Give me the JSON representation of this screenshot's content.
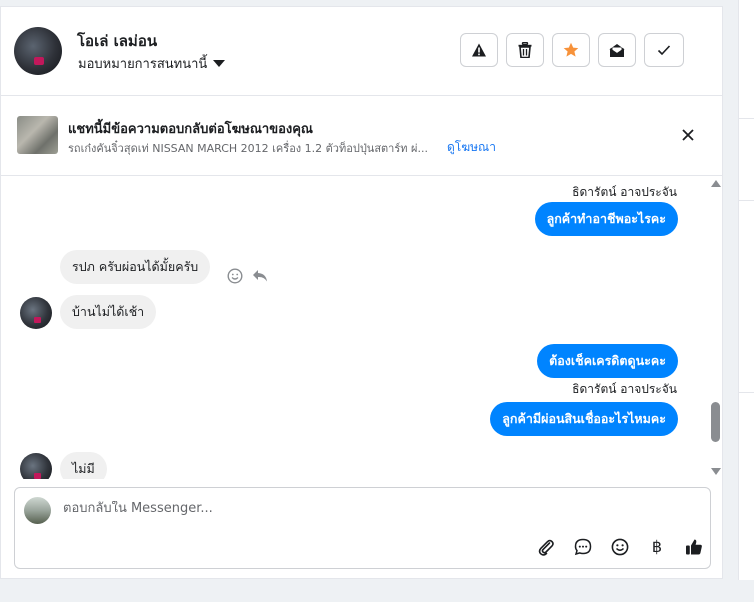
{
  "header": {
    "contact_name": "โอเล่ เลม่อน",
    "assign_label": "มอบหมายการสนทนานี้",
    "actions": [
      {
        "name": "report",
        "icon": "warning-icon"
      },
      {
        "name": "delete",
        "icon": "trash-icon"
      },
      {
        "name": "star",
        "icon": "star-icon"
      },
      {
        "name": "mark-unread",
        "icon": "envelope-open-icon"
      },
      {
        "name": "mark-done",
        "icon": "check-icon"
      }
    ]
  },
  "ad_banner": {
    "title": "แชทนี้มีข้อความตอบกลับต่อโฆษณาของคุณ",
    "subtitle": "รถเก๋งคันจิ๋วสุดเท่ NISSAN MARCH 2012 เครื่อง 1.2 ตัวท็อปปุ่นสตาร์ท ผ่...",
    "link": "ดูโฆษณา"
  },
  "messages": [
    {
      "type": "sender",
      "text": "ธิดารัตน์ อาจประจัน"
    },
    {
      "type": "outgoing",
      "text": "ลูกค้าทำอาชีพอะไรคะ"
    },
    {
      "type": "incoming",
      "text": "รปภ ครับผ่อนได้มั้ยครับ"
    },
    {
      "type": "incoming",
      "text": "บ้านไม่ได้เช้า"
    },
    {
      "type": "outgoing",
      "text": "ต้องเช็คเครดิตดูนะคะ"
    },
    {
      "type": "sender",
      "text": "ธิดารัตน์ อาจประจัน"
    },
    {
      "type": "outgoing",
      "text": "ลูกค้ามีผ่อนสินเชื่ออะไรไหมคะ"
    },
    {
      "type": "incoming",
      "text": "ไม่มี"
    }
  ],
  "composer": {
    "placeholder": "ตอบกลับใน Messenger...",
    "value": "",
    "tools": [
      "paperclip-icon",
      "chat-bubble-icon",
      "emoji-icon",
      "baht-icon",
      "thumbs-up-icon"
    ],
    "baht_symbol": "฿"
  },
  "colors": {
    "accent": "#0084ff",
    "incoming_bubble": "#f0f0f0",
    "star": "#f7923a",
    "link": "#1877f2"
  }
}
